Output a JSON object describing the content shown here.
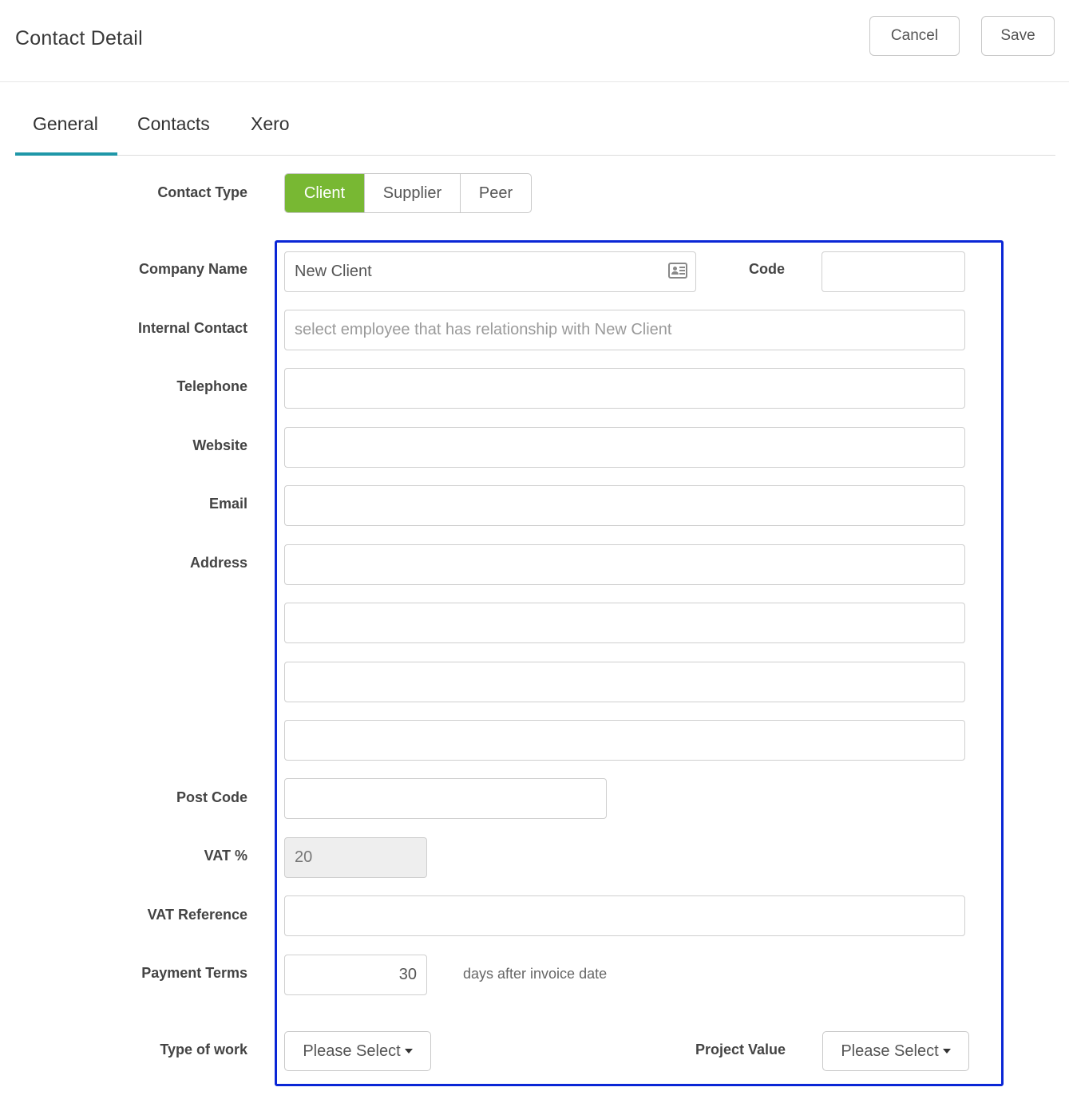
{
  "header": {
    "title": "Contact Detail",
    "cancel_label": "Cancel",
    "save_label": "Save"
  },
  "tabs": [
    {
      "label": "General",
      "active": true
    },
    {
      "label": "Contacts",
      "active": false
    },
    {
      "label": "Xero",
      "active": false
    }
  ],
  "contact_type": {
    "label": "Contact Type",
    "options": [
      "Client",
      "Supplier",
      "Peer"
    ],
    "selected": "Client"
  },
  "form": {
    "company_name": {
      "label": "Company Name",
      "value": "New Client",
      "icon": "contact-card-icon"
    },
    "code": {
      "label": "Code",
      "value": ""
    },
    "internal_contact": {
      "label": "Internal Contact",
      "placeholder": "select employee that has relationship with New Client"
    },
    "telephone": {
      "label": "Telephone",
      "value": ""
    },
    "website": {
      "label": "Website",
      "value": ""
    },
    "email": {
      "label": "Email",
      "value": ""
    },
    "address": {
      "label": "Address",
      "lines": [
        "",
        "",
        "",
        ""
      ]
    },
    "post_code": {
      "label": "Post Code",
      "value": ""
    },
    "vat_percent": {
      "label": "VAT %",
      "value": "20"
    },
    "vat_reference": {
      "label": "VAT Reference",
      "value": ""
    },
    "payment_terms": {
      "label": "Payment Terms",
      "value": "30",
      "suffix": "days after invoice date"
    },
    "type_of_work": {
      "label": "Type of work",
      "value": "Please Select"
    },
    "project_value": {
      "label": "Project Value",
      "value": "Please Select"
    }
  },
  "colors": {
    "accent_tab": "#1f97a8",
    "active_segment": "#78b833",
    "highlight_border": "#0a26d6"
  }
}
